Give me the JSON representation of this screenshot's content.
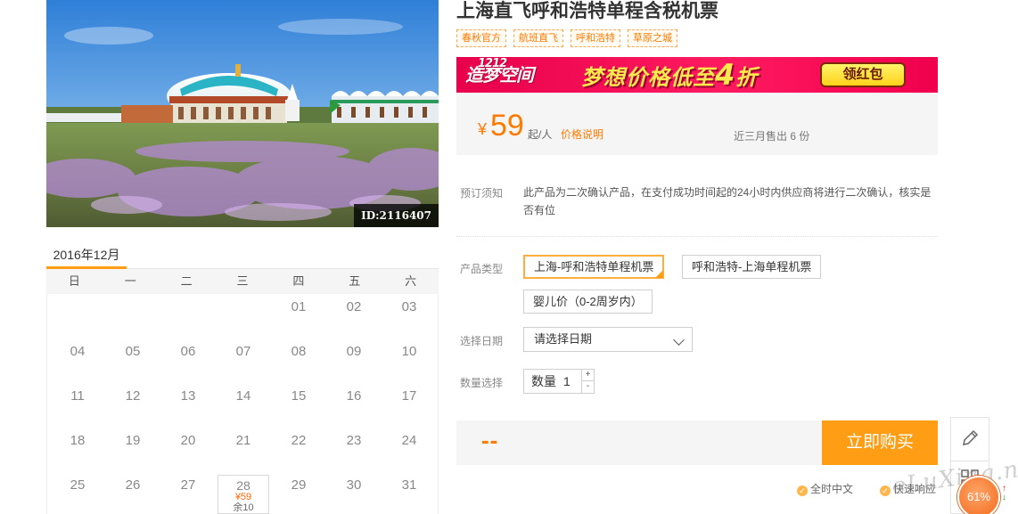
{
  "hero": {
    "image_id": "ID:2116407"
  },
  "calendar": {
    "month_label": "2016年12月",
    "weekdays": [
      "日",
      "一",
      "二",
      "三",
      "四",
      "五",
      "六"
    ],
    "weeks": [
      [
        "",
        "",
        "",
        "",
        "01",
        "02",
        "03"
      ],
      [
        "04",
        "05",
        "06",
        "07",
        "08",
        "09",
        "10"
      ],
      [
        "11",
        "12",
        "13",
        "14",
        "15",
        "16",
        "17"
      ],
      [
        "18",
        "19",
        "20",
        "21",
        "22",
        "23",
        "24"
      ],
      [
        "25",
        "26",
        "27",
        "28",
        "29",
        "30",
        "31"
      ]
    ],
    "available": {
      "day": "28",
      "price": "¥59",
      "stock": "余10"
    }
  },
  "product": {
    "title": "上海直飞呼和浩特单程含税机票",
    "tags": [
      "春秋官方",
      "航班直飞",
      "呼和浩特",
      "草原之城"
    ]
  },
  "banner": {
    "logo_small": "1212",
    "logo_text": "造梦空间",
    "text": "梦想价格低至",
    "highlight": "4",
    "suffix": "折",
    "button": "领红包"
  },
  "price": {
    "currency": "¥",
    "value": "59",
    "unit": "起/人",
    "link": "价格说明",
    "sold": "近三月售出 6 份"
  },
  "notice": {
    "label": "预订须知",
    "text": "此产品为二次确认产品，在支付成功时间起的24小时内供应商将进行二次确认，核实是否有位"
  },
  "options": {
    "type_label": "产品类型",
    "types": [
      "上海-呼和浩特单程机票",
      "呼和浩特-上海单程机票",
      "婴儿价（0-2周岁内）"
    ],
    "date_label": "选择日期",
    "date_placeholder": "请选择日期",
    "qty_label": "数量选择",
    "qty_prefix": "数量",
    "qty_value": "1",
    "qty_plus": "+",
    "qty_minus": "-"
  },
  "purchase": {
    "total": "--",
    "buy": "立即购买",
    "assure": [
      "全时中文",
      "快速响应"
    ]
  },
  "widgets": {
    "watermark": "eLuXing.net",
    "speed": "61%"
  },
  "colors": {
    "accent": "#ff9e14",
    "price": "#ff7a00",
    "banner": "#e8004c"
  }
}
